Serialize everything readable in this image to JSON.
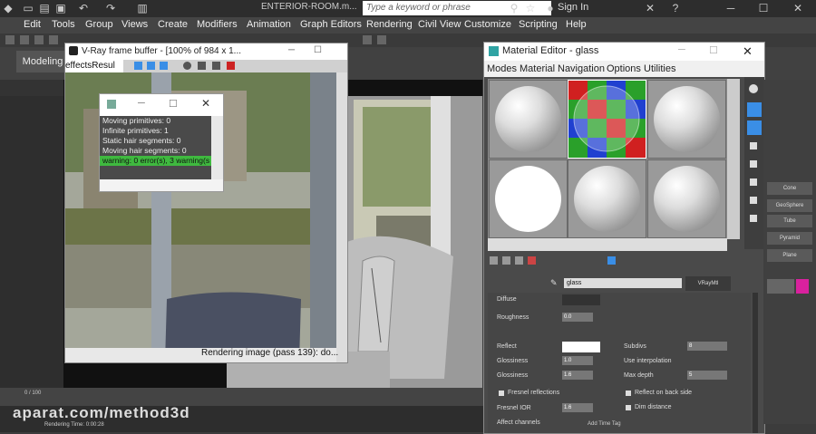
{
  "app": {
    "doc_title": "ENTERIOR-ROOM.m...",
    "search_placeholder": "Type a keyword or phrase",
    "signin_label": "Sign In"
  },
  "menu": [
    "Edit",
    "Tools",
    "Group",
    "Views",
    "Create",
    "Modifiers",
    "Animation",
    "Graph Editors",
    "Rendering",
    "Civil View",
    "Customize",
    "Scripting",
    "Help"
  ],
  "ribbon": {
    "modeling_tab": "Modeling"
  },
  "vfb": {
    "title": "V-Ray frame buffer - [100% of 984 x 1...",
    "effects_dropdown": "effectsResul",
    "status": "Rendering image (pass 139): do..."
  },
  "log": {
    "lines": [
      "Moving primitives: 0",
      "Infinite primitives: 1",
      "Static hair segments: 0",
      "Moving hair segments: 0"
    ],
    "warning": "warning: 0 error(s), 3 warning(s"
  },
  "material_editor": {
    "title": "Material Editor - glass",
    "menu": [
      "Modes",
      "Material",
      "Navigation",
      "Options",
      "Utilities"
    ],
    "material_name": "glass",
    "material_type": "VRayMtl",
    "params": {
      "diffuse": "Diffuse",
      "roughness": "Roughness",
      "roughness_val": "0.0",
      "reflect": "Reflect",
      "glossiness": "Glossiness",
      "glossiness_val": "1.0",
      "fresnel": "Fresnel reflections",
      "fresnel_ior": "Fresnel IOR",
      "subdivs": "Subdivs",
      "subdivs_val": "8",
      "max_depth": "Max depth",
      "max_depth_val": "5",
      "reflect_back": "Reflect on back side",
      "dim_distance": "Dim distance",
      "affect_channels": "Affect channels",
      "use_interp": "Use interpolation",
      "refr_glossiness_val": "1.6"
    }
  },
  "right_panel": {
    "buttons": [
      "Cone",
      "GeoSphere",
      "Tube",
      "Pyramid",
      "Plane"
    ]
  },
  "status": {
    "render_time": "Rendering Time: 0:00:28",
    "frame_counter": "0 / 100",
    "add_time_tag": "Add Time Tag"
  },
  "watermark": "aparat.com/method3d",
  "colors": {
    "accent_blue": "#3a8ee6",
    "warning_green": "#3fb93f",
    "swatch_magenta": "#d9219e"
  }
}
